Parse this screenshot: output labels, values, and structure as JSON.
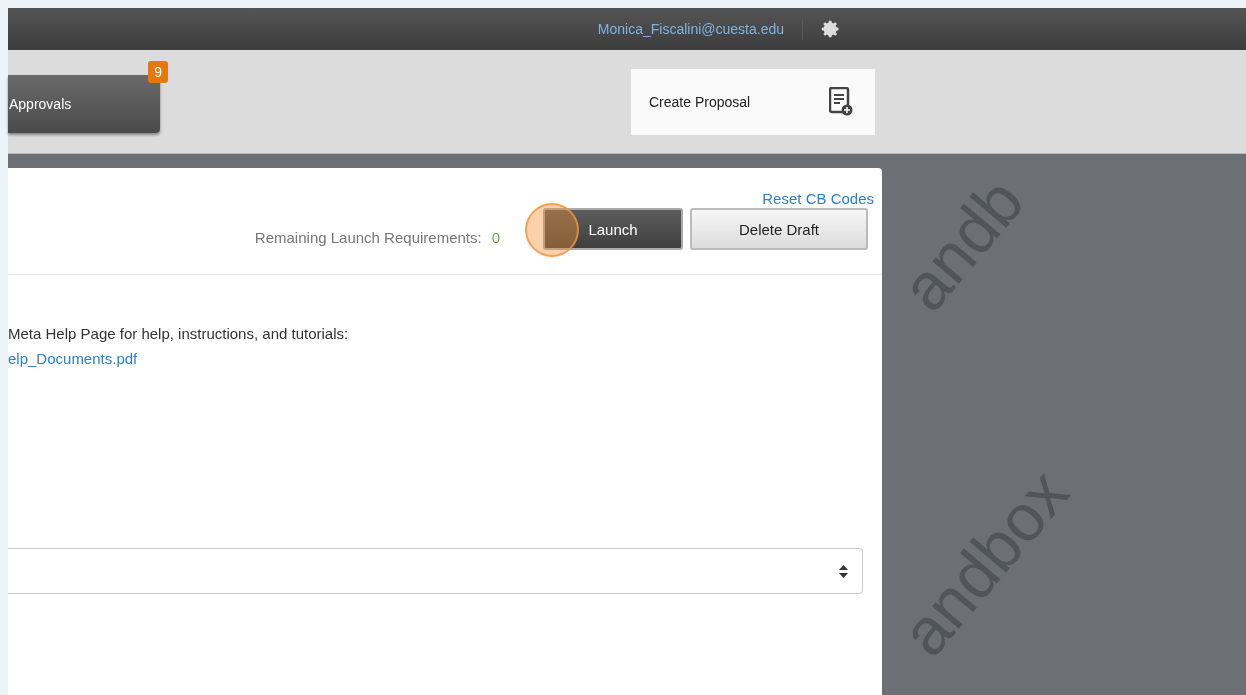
{
  "top_bar": {
    "user_email": "Monica_Fiscalini@cuesta.edu"
  },
  "toolbar": {
    "approvals": {
      "label": "Approvals",
      "badge": "9"
    },
    "create_proposal": {
      "label": "Create Proposal"
    }
  },
  "background_marks": [
    "andb",
    "andbox"
  ],
  "panel": {
    "reset_link": "Reset CB Codes",
    "requirements_label": "Remaining Launch Requirements:",
    "requirements_count": "0",
    "buttons": [
      {
        "label": "Launch",
        "kind": "primary",
        "clicked": true
      },
      {
        "label": "Delete Draft",
        "kind": "secondary",
        "clicked": false
      }
    ],
    "help_text": "Meta Help Page for help, instructions, and tutorials:",
    "help_link": "elp_Documents.pdf"
  }
}
